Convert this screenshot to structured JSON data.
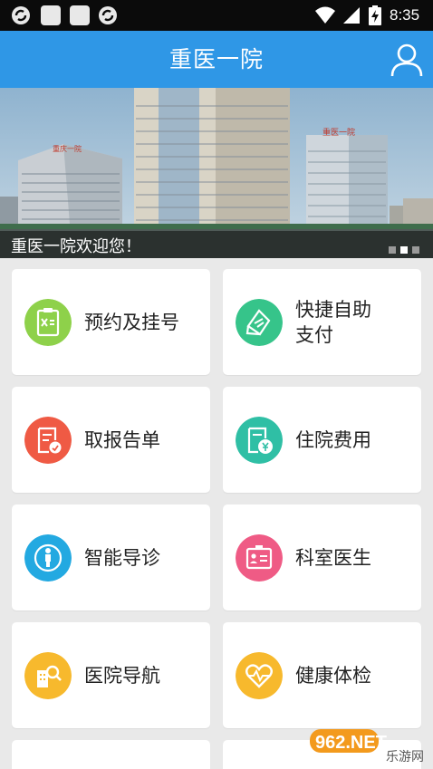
{
  "status_bar": {
    "time": "8:35",
    "icons": [
      "sync-icon",
      "square-icon",
      "square-icon",
      "sync-icon",
      "wifi-icon",
      "signal-icon",
      "battery-charging-icon"
    ]
  },
  "header": {
    "title": "重医一院",
    "user_icon": "user-icon",
    "color": "#2f97e6"
  },
  "banner": {
    "caption": "重医一院欢迎您！",
    "building_sign_left": "重庆一院",
    "building_sign_right": "重医一院",
    "slides": 3,
    "active_slide": 2
  },
  "menu": [
    {
      "label": "预约及挂号",
      "icon": "appointment-icon",
      "color": "#8ed14a"
    },
    {
      "label": "快捷自助支付",
      "icon": "payment-icon",
      "color": "#36c48a"
    },
    {
      "label": "取报告单",
      "icon": "report-icon",
      "color": "#ef5a44"
    },
    {
      "label": "住院费用",
      "icon": "hospital-fee-icon",
      "color": "#2fbfa5"
    },
    {
      "label": "智能导诊",
      "icon": "smart-guide-icon",
      "color": "#23a9e1"
    },
    {
      "label": "科室医生",
      "icon": "doctor-icon",
      "color": "#ef5b85"
    },
    {
      "label": "医院导航",
      "icon": "hospital-navigation-icon",
      "color": "#f7b92d"
    },
    {
      "label": "健康体检",
      "icon": "health-check-icon",
      "color": "#f7b92d"
    }
  ],
  "watermark": {
    "top": "962.NET",
    "bottom": "乐游网"
  }
}
